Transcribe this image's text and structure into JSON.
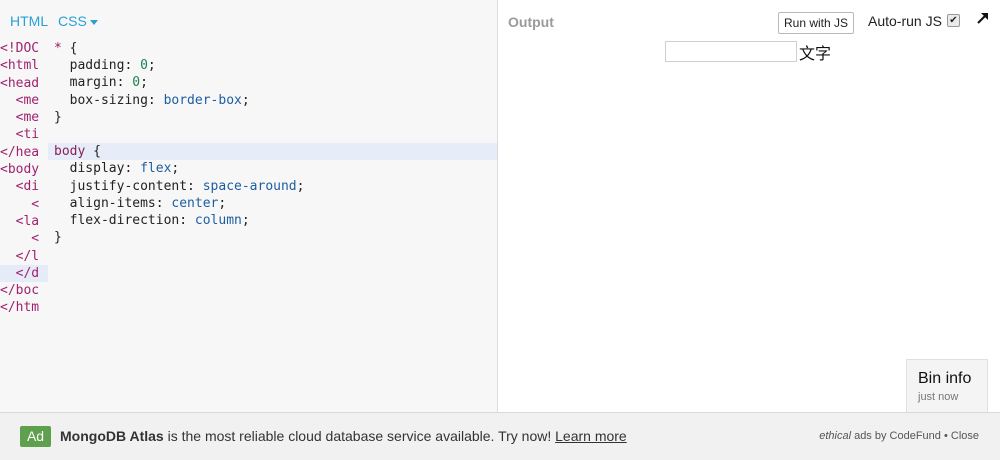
{
  "tabs": {
    "html_label": "HTML",
    "css_label": "CSS"
  },
  "html_panel": {
    "lines": [
      "<!DOC",
      "<html",
      "<head",
      "  <me",
      "  <me",
      "  <ti",
      "</hea",
      "<body",
      "  <di",
      "    <",
      "  <la",
      "    <",
      "  </l",
      "  </d",
      "</boc",
      "</htm"
    ],
    "highlight_line": 13
  },
  "css_code": {
    "lines": [
      [
        {
          "t": "* ",
          "c": "sel"
        },
        {
          "t": "{",
          "c": "punc"
        }
      ],
      [
        {
          "t": "  padding: ",
          "c": "prop"
        },
        {
          "t": "0",
          "c": "num"
        },
        {
          "t": ";",
          "c": "punc"
        }
      ],
      [
        {
          "t": "  margin: ",
          "c": "prop"
        },
        {
          "t": "0",
          "c": "num"
        },
        {
          "t": ";",
          "c": "punc"
        }
      ],
      [
        {
          "t": "  box-sizing: ",
          "c": "prop"
        },
        {
          "t": "border-box",
          "c": "val"
        },
        {
          "t": ";",
          "c": "punc"
        }
      ],
      [
        {
          "t": "}",
          "c": "punc"
        }
      ],
      [],
      [
        {
          "t": "body ",
          "c": "sel"
        },
        {
          "t": "{",
          "c": "punc"
        }
      ],
      [
        {
          "t": "  display: ",
          "c": "prop"
        },
        {
          "t": "flex",
          "c": "val"
        },
        {
          "t": ";",
          "c": "punc"
        }
      ],
      [
        {
          "t": "  justify-content: ",
          "c": "prop"
        },
        {
          "t": "space-around",
          "c": "val"
        },
        {
          "t": ";",
          "c": "punc"
        }
      ],
      [
        {
          "t": "  align-items: ",
          "c": "prop"
        },
        {
          "t": "center",
          "c": "val"
        },
        {
          "t": ";",
          "c": "punc"
        }
      ],
      [
        {
          "t": "  flex-direction: ",
          "c": "prop"
        },
        {
          "t": "column",
          "c": "val"
        },
        {
          "t": ";",
          "c": "punc"
        }
      ],
      [
        {
          "t": "}",
          "c": "punc"
        }
      ]
    ],
    "highlight_line": 6
  },
  "output": {
    "label": "Output",
    "run_button": "Run with JS",
    "autorun_label": "Auto-run JS",
    "autorun_checked": true,
    "input_value": "",
    "text": "文字",
    "expand_icon": "diagonal-arrow-icon"
  },
  "bin_info": {
    "title": "Bin info",
    "subtitle": "just now"
  },
  "ad": {
    "badge": "Ad",
    "brand": "MongoDB Atlas",
    "message": " is the most reliable cloud database service available. Try now! ",
    "link": "Learn more",
    "right_ethical": "ethical",
    "right_rest": " ads by CodeFund • Close"
  },
  "colors": {
    "tab_accent": "#2a9fd6",
    "ad_badge": "#5fa04e",
    "html_tag": "#a0226f",
    "css_value": "#1d5ea0",
    "css_number": "#208050"
  }
}
